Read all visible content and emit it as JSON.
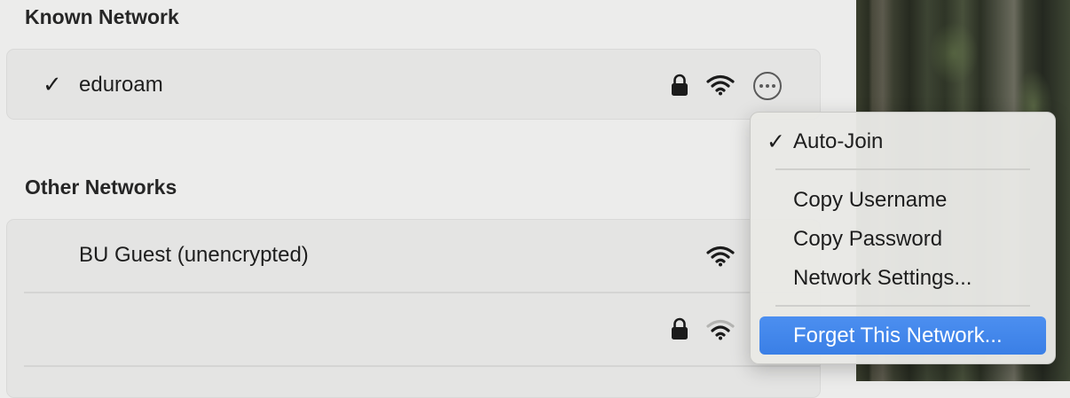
{
  "known": {
    "heading": "Known Network",
    "network": {
      "check": "✓",
      "name": "eduroam",
      "icons": [
        "lock-icon",
        "wifi-full-icon",
        "more-options-icon"
      ]
    }
  },
  "other": {
    "heading": "Other Networks",
    "networks": [
      {
        "name": "BU Guest (unencrypted)",
        "icons": [
          "wifi-full-icon"
        ]
      },
      {
        "name": "",
        "icons": [
          "lock-icon",
          "wifi-weak-icon"
        ]
      }
    ]
  },
  "context_menu": {
    "items": [
      {
        "label": "Auto-Join",
        "checked": true,
        "check": "✓"
      },
      {
        "label": "Copy Username"
      },
      {
        "label": "Copy Password"
      },
      {
        "label": "Network Settings..."
      },
      {
        "label": "Forget This Network...",
        "highlighted": true
      }
    ],
    "highlight_color": "#3d82e8"
  }
}
